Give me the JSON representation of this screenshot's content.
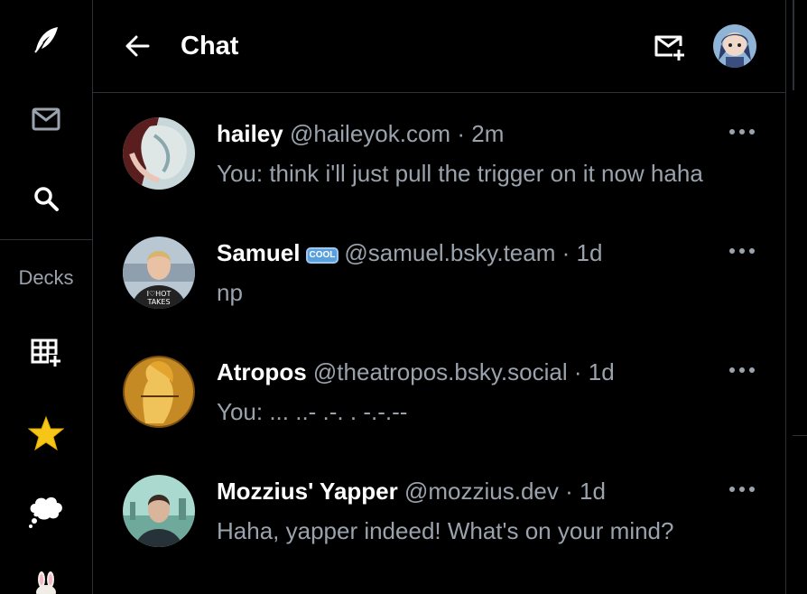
{
  "header": {
    "title": "Chat"
  },
  "sidebar": {
    "decks_label": "Decks",
    "icons": [
      "feather-icon",
      "mail-icon",
      "search-icon",
      "grid-add-icon",
      "star-icon",
      "thought-bubble-icon",
      "bunny-icon"
    ]
  },
  "conversations": [
    {
      "name": "hailey",
      "badge": "",
      "handle": "@haileyok.com",
      "separator": "·",
      "time": "2m",
      "message": "You: think i'll just pull the trigger on it now haha",
      "unread": false
    },
    {
      "name": "Samuel",
      "badge": "COOL",
      "handle": "@samuel.bsky.team",
      "separator": "·",
      "time": "1d",
      "message": "np",
      "unread": false
    },
    {
      "name": "Atropos",
      "badge": "",
      "handle": "@theatropos.bsky.social",
      "separator": "·",
      "time": "1d",
      "message": "You: ... ..- .-. . -.-.--",
      "unread": false
    },
    {
      "name": "Mozzius' Yapper",
      "badge": "",
      "handle": "@mozzius.dev",
      "separator": "·",
      "time": "1d",
      "message": "Haha, yapper indeed! What's on your mind?",
      "unread": false
    }
  ],
  "colors": {
    "background": "#000000",
    "border": "#2e3136",
    "muted": "#9aa3ad",
    "star": "#f5c518"
  }
}
